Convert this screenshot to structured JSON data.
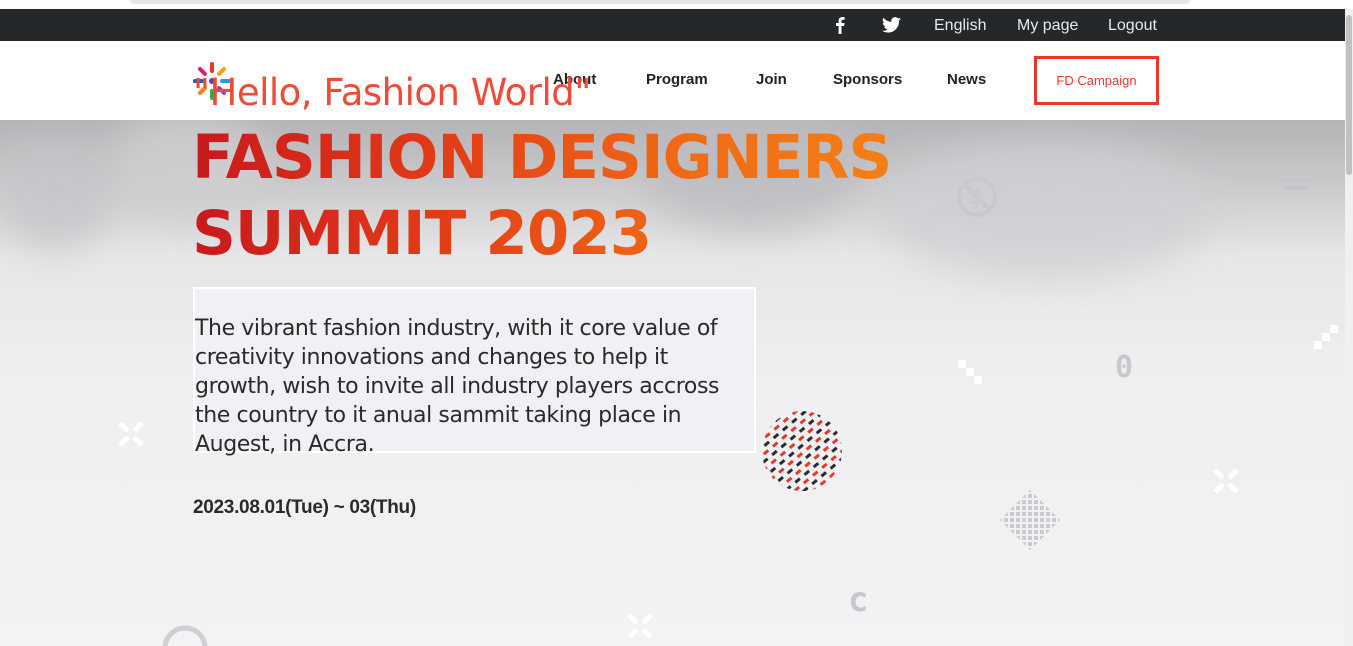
{
  "topbar": {
    "facebook_icon": "facebook-icon",
    "twitter_icon": "twitter-icon",
    "language": "English",
    "my_page": "My page",
    "logout": "Logout"
  },
  "header": {
    "logo": "logo-icon",
    "nav": [
      "About",
      "Program",
      "Join",
      "Sponsors",
      "News"
    ],
    "campaign": "FD Campaign"
  },
  "hero": {
    "tagline": "\"Hello, Fashion World\"",
    "title_line1": "FASHION DESIGNERS",
    "title_line2": "SUMMIT 2023",
    "description": "The vibrant fashion industry, with it core value of creativity innovations and changes to help it growth, wish to invite all industry players accross the country to it anual sammit taking place in Augest, in Accra.",
    "date": "2023.08.01(Tue) ~ 03(Thu)"
  },
  "colors": {
    "accent": "#e8382a",
    "topbar": "#25282b",
    "title_start": "#c8191c",
    "title_end": "#f47f16"
  }
}
